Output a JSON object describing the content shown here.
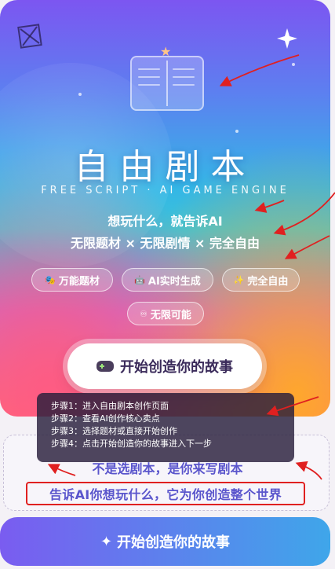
{
  "hero": {
    "title": "自由剧本",
    "subtitle_en": "FREE SCRIPT · AI GAME ENGINE",
    "tagline_1": "想玩什么，就告诉AI",
    "tagline_2": "无限题材 × 无限剧情 × 完全自由",
    "chips": [
      {
        "icon": "theater-masks-icon",
        "label": "万能题材"
      },
      {
        "icon": "robot-icon",
        "label": "AI实时生成"
      },
      {
        "icon": "sparkle-wand-icon",
        "label": "完全自由"
      },
      {
        "icon": "infinity-icon",
        "label": "无限可能"
      }
    ],
    "start_button_label": "开始创造你的故事"
  },
  "tooltip": {
    "steps": [
      "步骤1：进入自由剧本创作页面",
      "步骤2：查看AI创作核心卖点",
      "步骤3：选择题材或直接开始创作",
      "步骤4：点击开始创造你的故事进入下一步"
    ]
  },
  "promo": {
    "line_1": "不是选剧本，是你来写剧本",
    "line_2": "告诉AI你想玩什么，它为你创造整个世界"
  },
  "bottom_button": {
    "icon": "sparkle-icon",
    "label": "开始创造你的故事"
  },
  "colors": {
    "annotation_red": "#e02020",
    "promo_text": "#5a55cc",
    "bottom_gradient_start": "#7a5cf0",
    "bottom_gradient_end": "#3fa6ea"
  }
}
